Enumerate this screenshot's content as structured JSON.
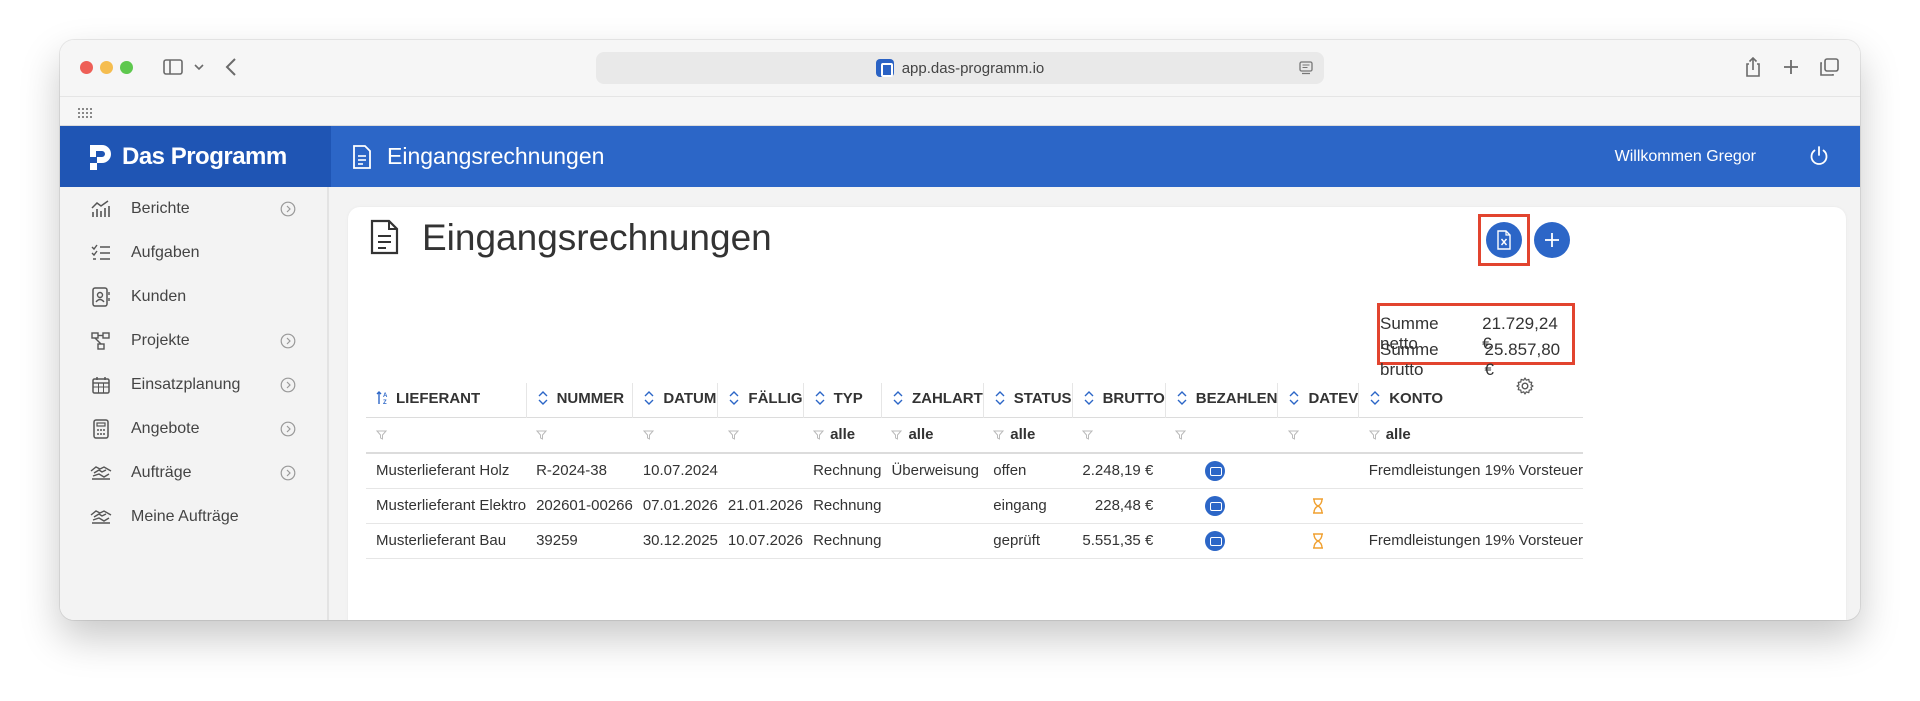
{
  "browser": {
    "url": "app.das-programm.io"
  },
  "app": {
    "brand": "Das Programm",
    "header_title": "Eingangsrechnungen",
    "welcome": "Willkommen Gregor"
  },
  "sidebar": {
    "items": [
      {
        "label": "Berichte",
        "icon": "chart-icon",
        "chevron": true
      },
      {
        "label": "Aufgaben",
        "icon": "checklist-icon",
        "chevron": false
      },
      {
        "label": "Kunden",
        "icon": "contacts-icon",
        "chevron": false
      },
      {
        "label": "Projekte",
        "icon": "hierarchy-icon",
        "chevron": true
      },
      {
        "label": "Einsatzplanung",
        "icon": "calendar-icon",
        "chevron": true
      },
      {
        "label": "Angebote",
        "icon": "calculator-icon",
        "chevron": true
      },
      {
        "label": "Aufträge",
        "icon": "handshake-icon",
        "chevron": true
      },
      {
        "label": "Meine Aufträge",
        "icon": "handshake-icon",
        "chevron": false
      }
    ]
  },
  "page": {
    "title": "Eingangsrechnungen",
    "sum_netto_label": "Summe netto",
    "sum_netto_value": "21.729,24 €",
    "sum_brutto_label": "Summe brutto",
    "sum_brutto_value": "25.857,80 €"
  },
  "table": {
    "columns": [
      "LIEFERANT",
      "NUMMER",
      "DATUM",
      "FÄLLIG",
      "TYP",
      "ZAHLART",
      "STATUS",
      "BRUTTO",
      "BEZAHLEN",
      "DATEV",
      "KONTO"
    ],
    "filters": {
      "typ": "alle",
      "zahlart": "alle",
      "status": "alle",
      "konto": "alle"
    },
    "rows": [
      {
        "lieferant": "Musterlieferant Holz",
        "nummer": "R-2024-38",
        "datum": "10.07.2024",
        "faellig": "",
        "typ": "Rechnung",
        "zahlart": "Überweisung",
        "status": "offen",
        "brutto": "2.248,19 €",
        "datev_pending": false,
        "konto": "Fremdleistungen 19% Vorsteuer"
      },
      {
        "lieferant": "Musterlieferant Elektro",
        "nummer": "202601-00266",
        "datum": "07.01.2026",
        "faellig": "21.01.2026",
        "typ": "Rechnung",
        "zahlart": "",
        "status": "eingang",
        "brutto": "228,48 €",
        "datev_pending": true,
        "konto": ""
      },
      {
        "lieferant": "Musterlieferant Bau",
        "nummer": "39259",
        "datum": "30.12.2025",
        "faellig": "10.07.2026",
        "typ": "Rechnung",
        "zahlart": "",
        "status": "geprüft",
        "brutto": "5.551,35 €",
        "datev_pending": true,
        "konto": "Fremdleistungen 19% Vorsteuer"
      }
    ]
  },
  "colors": {
    "brand_dark": "#1f55b4",
    "brand": "#2c66c7",
    "highlight": "#e2442f",
    "pending": "#f0a030"
  }
}
